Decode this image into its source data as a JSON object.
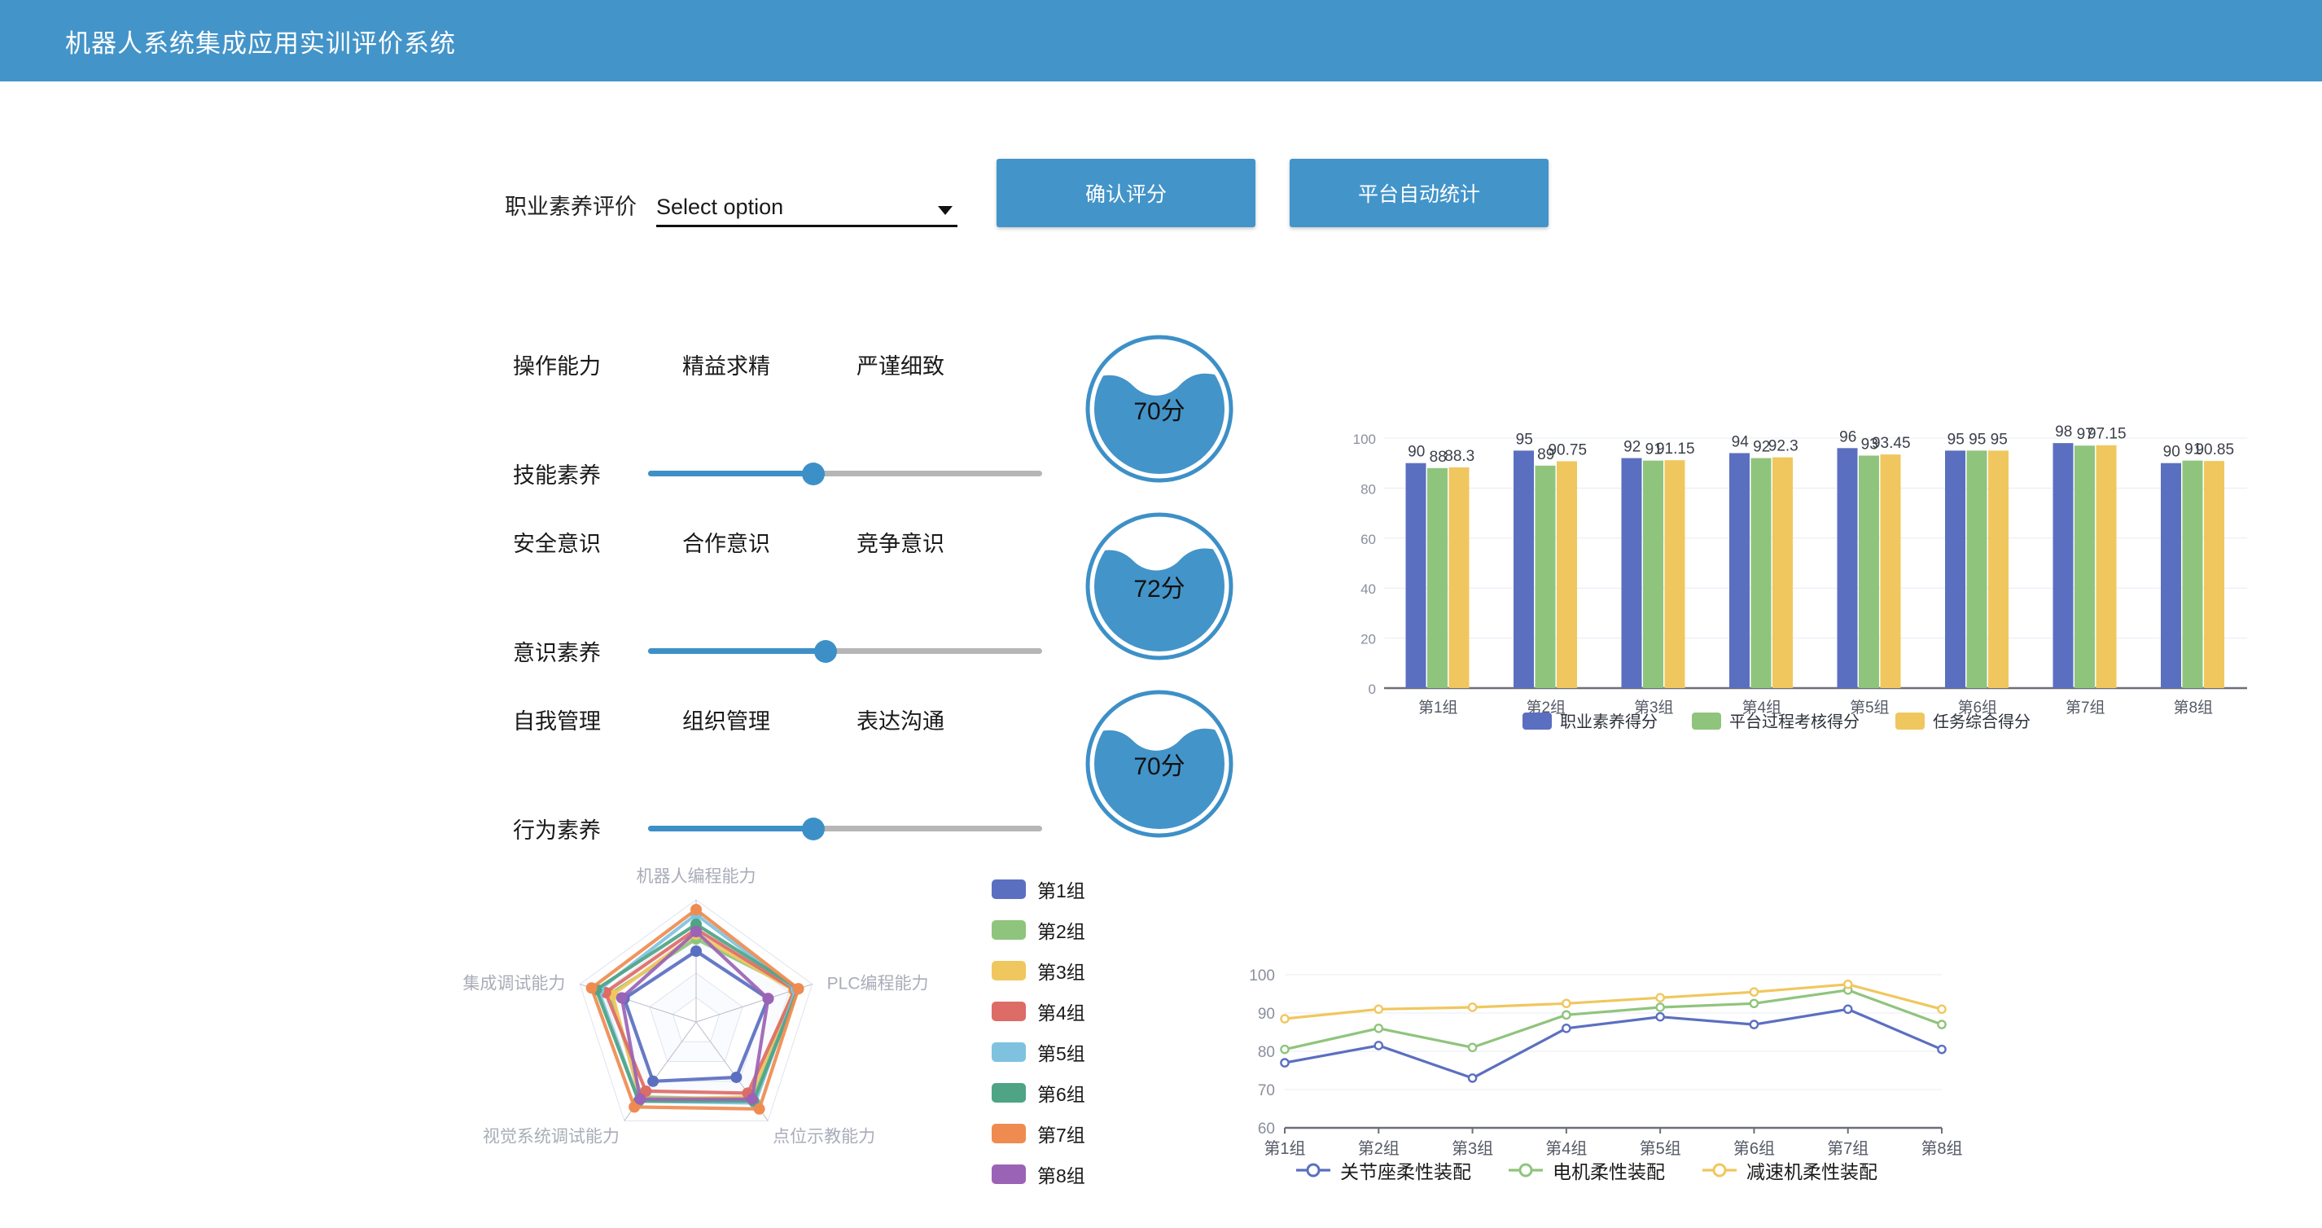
{
  "header": {
    "title": "机器人系统集成应用实训评价系统",
    "bg_color": "#4394c9"
  },
  "toolbar": {
    "eval_label": "职业素养评价",
    "select": {
      "value": "Select option",
      "placeholder": "Select option",
      "caret_icon": "chevron-down-icon"
    },
    "confirm_button": "确认评分",
    "auto_stat_button": "平台自动统计"
  },
  "evaluation": {
    "blocks": [
      {
        "tags": [
          "操作能力",
          "精益求精",
          "严谨细致"
        ],
        "slider_label": "技能素养",
        "slider_percent": 42,
        "gauge_value": "70分",
        "gauge_percent": 70
      },
      {
        "tags": [
          "安全意识",
          "合作意识",
          "竞争意识"
        ],
        "slider_label": "意识素养",
        "slider_percent": 45,
        "gauge_value": "72分",
        "gauge_percent": 72
      },
      {
        "tags": [
          "自我管理",
          "组织管理",
          "表达沟通"
        ],
        "slider_label": "行为素养",
        "slider_percent": 42,
        "gauge_value": "70分",
        "gauge_percent": 70
      }
    ]
  },
  "colors": {
    "accent": "#4394c9",
    "series": [
      "#5b6fc0",
      "#8fc47d",
      "#f0c75e",
      "#dd6b66",
      "#7fc2e0",
      "#4ea484",
      "#ef8b50",
      "#9b63b5"
    ],
    "bar_series": [
      "#5b6fc0",
      "#8fc47d",
      "#f0c75e"
    ],
    "line_series": [
      "#5b6fc0",
      "#8fc47d",
      "#f0c75e"
    ]
  },
  "chart_data": [
    {
      "type": "bar",
      "id": "group-scores-bar",
      "title": "",
      "xlabel": "",
      "ylabel": "",
      "ylim": [
        0,
        100
      ],
      "yticks": [
        0,
        20,
        40,
        60,
        80,
        100
      ],
      "grid": true,
      "legend_position": "bottom",
      "categories": [
        "第1组",
        "第2组",
        "第3组",
        "第4组",
        "第5组",
        "第6组",
        "第7组",
        "第8组"
      ],
      "series": [
        {
          "name": "职业素养得分",
          "color": "#5b6fc0",
          "values": [
            90,
            95,
            92,
            94,
            96,
            95,
            98,
            90
          ]
        },
        {
          "name": "平台过程考核得分",
          "color": "#8fc47d",
          "values": [
            88,
            89,
            91,
            92,
            93,
            95,
            97,
            91
          ]
        },
        {
          "name": "任务综合得分",
          "color": "#f0c75e",
          "values": [
            88.3,
            90.75,
            91.15,
            92.3,
            93.45,
            95,
            97.15,
            90.85
          ]
        }
      ],
      "data_labels": [
        [
          "90",
          "88",
          "88.3"
        ],
        [
          "95",
          "89",
          "90.75"
        ],
        [
          "92",
          "91",
          "91.15"
        ],
        [
          "94",
          "92",
          "92.3"
        ],
        [
          "96",
          "93",
          "93.45"
        ],
        [
          "95",
          "95",
          "95"
        ],
        [
          "98",
          "97",
          "97.15"
        ],
        [
          "90",
          "91",
          "90.85"
        ]
      ]
    },
    {
      "type": "radar",
      "id": "capability-radar",
      "title": "",
      "legend_position": "right",
      "max": 100,
      "rings": 5,
      "indicators": [
        "机器人编程能力",
        "PLC编程能力",
        "点位示教能力",
        "视觉系统调试能力",
        "集成调试能力"
      ],
      "series": [
        {
          "name": "第1组",
          "color": "#5b6fc0",
          "values": [
            58,
            62,
            56,
            60,
            62
          ]
        },
        {
          "name": "第2组",
          "color": "#8fc47d",
          "values": [
            68,
            86,
            78,
            76,
            74
          ]
        },
        {
          "name": "第3组",
          "color": "#f0c75e",
          "values": [
            72,
            84,
            76,
            78,
            72
          ]
        },
        {
          "name": "第4组",
          "color": "#dd6b66",
          "values": [
            76,
            85,
            72,
            70,
            78
          ]
        },
        {
          "name": "第5组",
          "color": "#7fc2e0",
          "values": [
            88,
            86,
            82,
            80,
            84
          ]
        },
        {
          "name": "第6组",
          "color": "#4ea484",
          "values": [
            80,
            88,
            80,
            80,
            86
          ]
        },
        {
          "name": "第7组",
          "color": "#ef8b50",
          "values": [
            92,
            88,
            88,
            86,
            90
          ]
        },
        {
          "name": "第8组",
          "color": "#9b63b5",
          "values": [
            74,
            62,
            78,
            78,
            64
          ]
        }
      ]
    },
    {
      "type": "line",
      "id": "flexible-assembly-line",
      "title": "",
      "xlabel": "",
      "ylabel": "",
      "ylim": [
        60,
        100
      ],
      "yticks": [
        60,
        70,
        80,
        90,
        100
      ],
      "grid": true,
      "legend_position": "bottom",
      "categories": [
        "第1组",
        "第2组",
        "第3组",
        "第4组",
        "第5组",
        "第6组",
        "第7组",
        "第8组"
      ],
      "series": [
        {
          "name": "关节座柔性装配",
          "color": "#5b6fc0",
          "values": [
            77,
            81.5,
            73,
            86,
            89,
            87,
            91,
            80.5
          ]
        },
        {
          "name": "电机柔性装配",
          "color": "#8fc47d",
          "values": [
            80.5,
            86,
            81,
            89.5,
            91.5,
            92.5,
            96,
            87
          ]
        },
        {
          "name": "减速机柔性装配",
          "color": "#f0c75e",
          "values": [
            88.5,
            91,
            91.5,
            92.5,
            94,
            95.5,
            97.5,
            91
          ]
        }
      ]
    }
  ]
}
